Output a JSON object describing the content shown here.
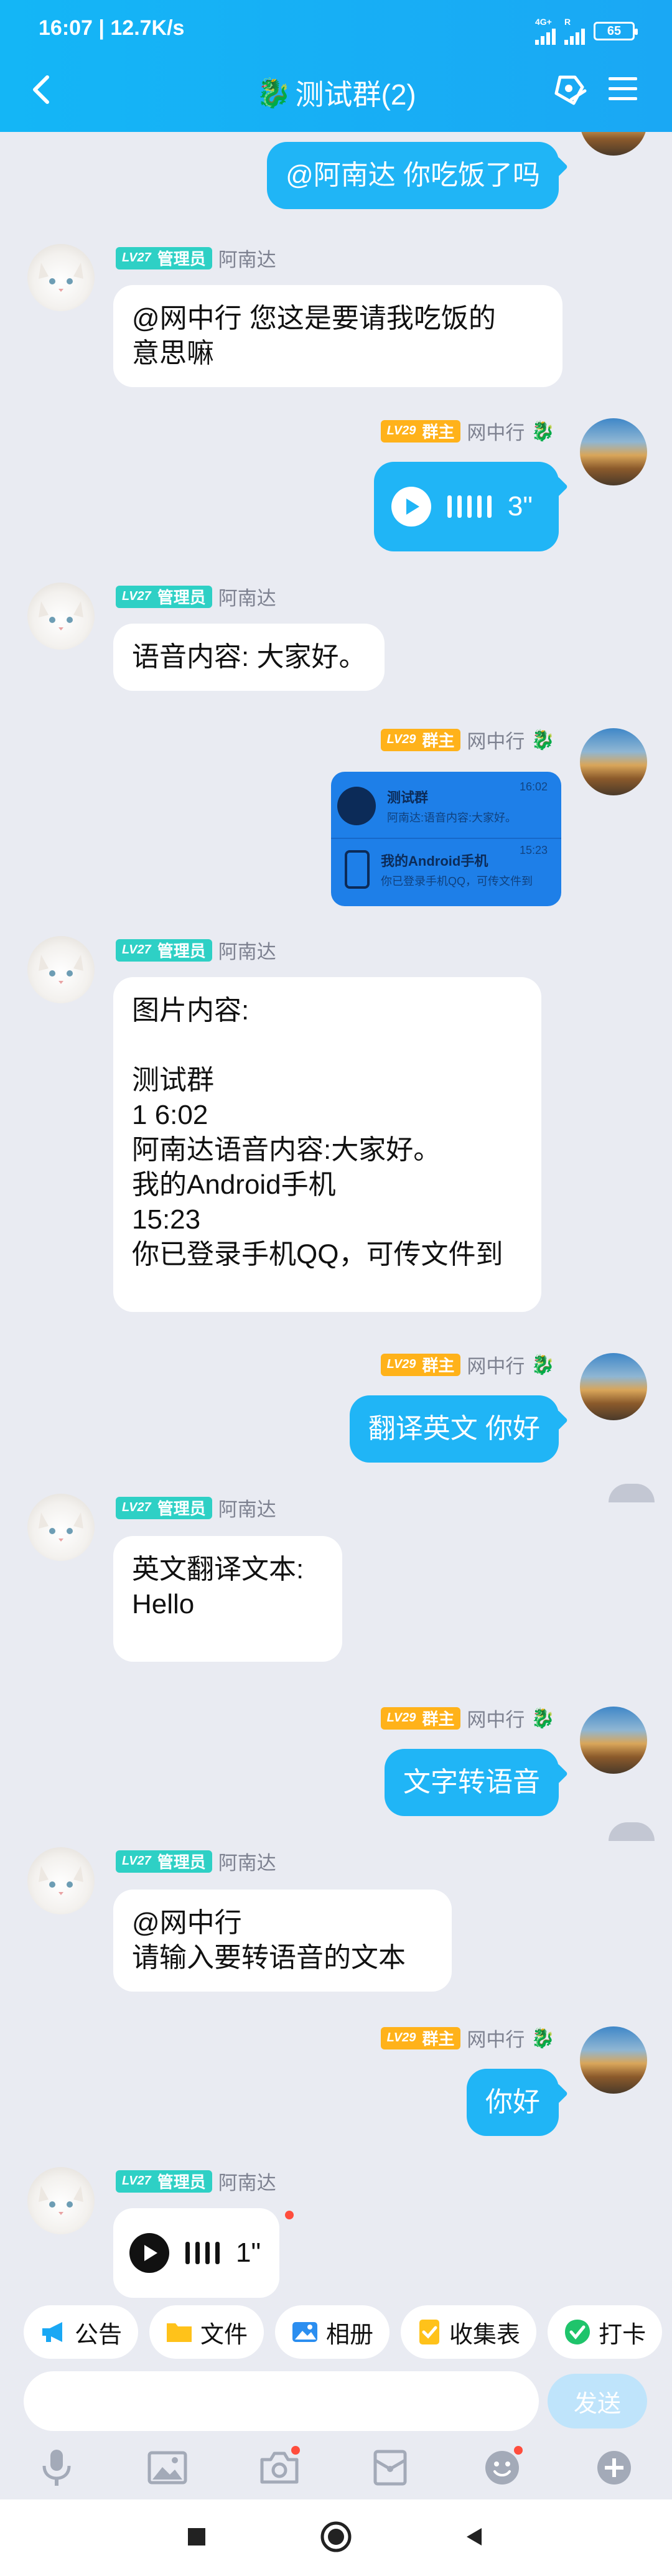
{
  "status": {
    "time": "16:07",
    "speed": "12.7K/s",
    "net1": "4G+",
    "net2": "R",
    "battery": "65"
  },
  "header": {
    "title": "测试群(2)",
    "group_emoji": "🐉"
  },
  "roles": {
    "admin_level": "LV27",
    "admin_title": "管理员",
    "owner_level": "LV29",
    "owner_title": "群主"
  },
  "users": {
    "admin_name": "阿南达",
    "owner_name": "网中行",
    "owner_badge": "🐉"
  },
  "messages": {
    "m1": "@阿南达 你吃饭了吗",
    "m2": "@网中行 您这是要请我吃饭的\n意思嘛",
    "m3_duration": "3\"",
    "m4": "语音内容: 大家好。",
    "m6": "图片内容:\n\n测试群\n1 6:02\n阿南达语音内容:大家好。\n我的Android手机\n15:23\n你已登录手机QQ，可传文件到",
    "m7": "翻译英文 你好",
    "m8": "英文翻译文本:\nHello",
    "m9": "文字转语音",
    "m10": "@网中行\n请输入要转语音的文本",
    "m11": "你好",
    "m12_duration": "1\""
  },
  "image_card": {
    "row1_title": "测试群",
    "row1_sub": "阿南达:语音内容:大家好。",
    "row1_time": "16:02",
    "row2_title": "我的Android手机",
    "row2_sub": "你已登录手机QQ，可传文件到",
    "row2_time": "15:23"
  },
  "quick_actions": {
    "announce": "公告",
    "files": "文件",
    "album": "相册",
    "form": "收集表",
    "checkin": "打卡"
  },
  "composer": {
    "send": "发送",
    "placeholder": ""
  },
  "colors": {
    "accent": "#20b5f6",
    "header": "#14b6f6",
    "admin_badge": "#2ed0c5",
    "owner_badge": "#ffb21a"
  }
}
